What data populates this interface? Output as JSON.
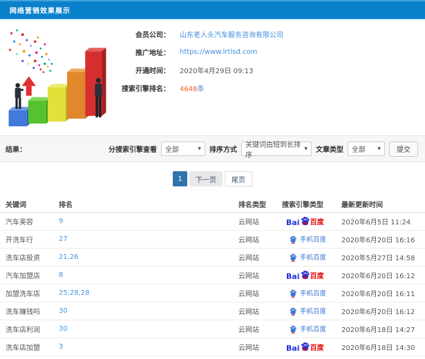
{
  "header": {
    "title": "网络营销效果展示"
  },
  "info": {
    "fields": [
      {
        "label": "会员公司：",
        "value": "山东老人头汽车服务咨询有限公司"
      },
      {
        "label": "推广地址：",
        "value": "https://www.lrtlsd.com"
      },
      {
        "label": "开通时间：",
        "value": "2020年4月29日 09:13"
      },
      {
        "label": "搜索引擎排名：",
        "value": "4648",
        "suffix": "条"
      }
    ]
  },
  "filters": {
    "result_label": "结果：",
    "engine_label": "分搜索引擎查看",
    "engine_value": "全部",
    "sort_label": "排序方式",
    "sort_value": "关键词由短到长排序",
    "article_label": "文章类型",
    "article_value": "全部",
    "submit_label": "提交"
  },
  "pagination": {
    "current": "1",
    "next": "下一页",
    "last": "尾页"
  },
  "table": {
    "headers": [
      "关键词",
      "排名",
      "排名类型",
      "搜索引擎类型",
      "最新更新时间"
    ],
    "rows": [
      {
        "keyword": "汽车美容",
        "rank": "9",
        "rank_type": "云网站",
        "engine": "baidu_pc",
        "updated": "2020年6月5日 11:24"
      },
      {
        "keyword": "开洗车行",
        "rank": "27",
        "rank_type": "云网站",
        "engine": "baidu_mobile",
        "updated": "2020年6月20日 16:16"
      },
      {
        "keyword": "洗车店投资",
        "rank": "21,26",
        "rank_type": "云网站",
        "engine": "baidu_mobile",
        "updated": "2020年5月27日 14:58"
      },
      {
        "keyword": "汽车加盟店",
        "rank": "8",
        "rank_type": "云网站",
        "engine": "baidu_pc",
        "updated": "2020年6月20日 16:12"
      },
      {
        "keyword": "加盟洗车店",
        "rank": "25,28,28",
        "rank_type": "云网站",
        "engine": "baidu_mobile",
        "updated": "2020年6月20日 16:11"
      },
      {
        "keyword": "洗车赚钱吗",
        "rank": "30",
        "rank_type": "云网站",
        "engine": "baidu_mobile",
        "updated": "2020年6月20日 16:12"
      },
      {
        "keyword": "洗车店利润",
        "rank": "30",
        "rank_type": "云网站",
        "engine": "baidu_mobile",
        "updated": "2020年6月18日 14:27"
      },
      {
        "keyword": "洗车店加盟",
        "rank": "3",
        "rank_type": "云网站",
        "engine": "baidu_pc",
        "updated": "2020年6月18日 14:30"
      }
    ]
  },
  "logos": {
    "baidu_pc": {
      "latin": "Bai",
      "du": "du",
      "cn": "百度",
      "blue": "#2534dc",
      "red": "#e10601"
    },
    "baidu_mobile": {
      "text": "手机百度",
      "color": "#3a76d2",
      "accent": "#e10601"
    }
  },
  "colors": {
    "header_bg": "#0a81cb",
    "link": "#3e8ddc",
    "highlight": "#ff5722",
    "page_active": "#3173ad"
  }
}
